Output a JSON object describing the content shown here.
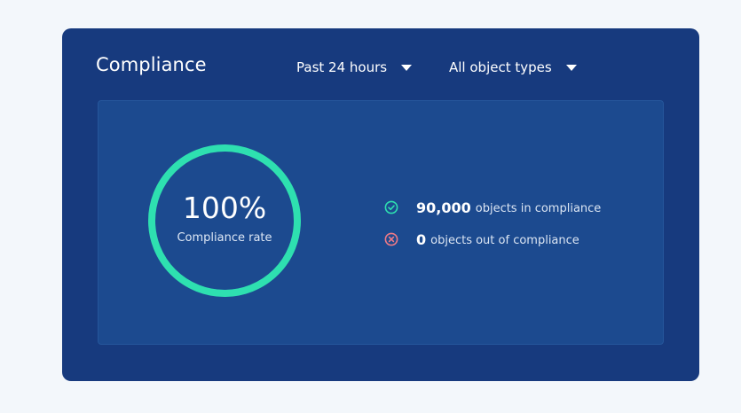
{
  "card": {
    "title": "Compliance",
    "filters": {
      "time_range": "Past 24 hours",
      "object_type": "All object types"
    }
  },
  "summary": {
    "compliance_rate": "100%",
    "compliance_rate_fraction": 1.0,
    "compliance_rate_label": "Compliance rate",
    "in_compliance": {
      "count": "90,000",
      "label": "objects in compliance",
      "icon": "check-circle-icon"
    },
    "out_of_compliance": {
      "count": "0",
      "label": "objects out of compliance",
      "icon": "x-circle-icon"
    }
  },
  "colors": {
    "card_bg": "#173a7e",
    "panel_bg": "#1c4a8f",
    "ring": "#2ee0b0",
    "ok": "#2ee0b0",
    "error": "#f07a86"
  }
}
